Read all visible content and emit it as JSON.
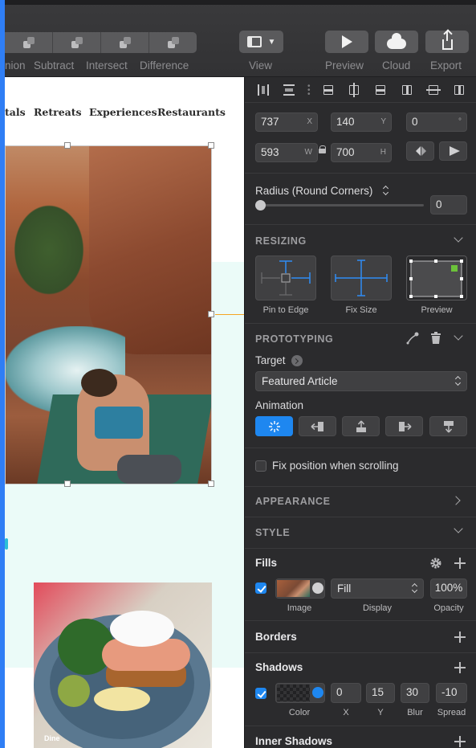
{
  "toolbar": {
    "boolean_labels": [
      "nion",
      "Subtract",
      "Intersect",
      "Difference"
    ],
    "view_label": "View",
    "preview_label": "Preview",
    "cloud_label": "Cloud",
    "export_label": "Export"
  },
  "canvas": {
    "nav_items": [
      "tals",
      "Retreats",
      "Experiences",
      "Restaurants"
    ],
    "card_label": "Dine",
    "accent_mint": "#ebfbf8",
    "connector_color": "#f5a623"
  },
  "inspector": {
    "position": {
      "x": "737",
      "x_suffix": "X",
      "y": "140",
      "y_suffix": "Y",
      "rotation": "0",
      "rotation_suffix": "°",
      "w": "593",
      "w_suffix": "W",
      "h": "700",
      "h_suffix": "H"
    },
    "radius": {
      "label": "Radius (Round Corners)",
      "value": "0"
    },
    "resizing": {
      "title": "RESIZING",
      "options": [
        "Pin to Edge",
        "Fix Size",
        "Preview"
      ]
    },
    "prototyping": {
      "title": "PROTOTYPING",
      "target_label": "Target",
      "target_value": "Featured Article",
      "animation_label": "Animation",
      "fix_position_label": "Fix position when scrolling",
      "fix_position_checked": false
    },
    "appearance_title": "APPEARANCE",
    "style_title": "STYLE",
    "fills": {
      "title": "Fills",
      "enabled": true,
      "display": "Fill",
      "opacity": "100%",
      "column_labels": [
        "Image",
        "Display",
        "Opacity"
      ]
    },
    "borders_title": "Borders",
    "shadows": {
      "title": "Shadows",
      "enabled": true,
      "x": "0",
      "y": "15",
      "blur": "30",
      "spread": "-10",
      "column_labels": [
        "Color",
        "X",
        "Y",
        "Blur",
        "Spread"
      ]
    },
    "inner_shadows_title": "Inner Shadows",
    "accent_color": "#1e87f0"
  }
}
